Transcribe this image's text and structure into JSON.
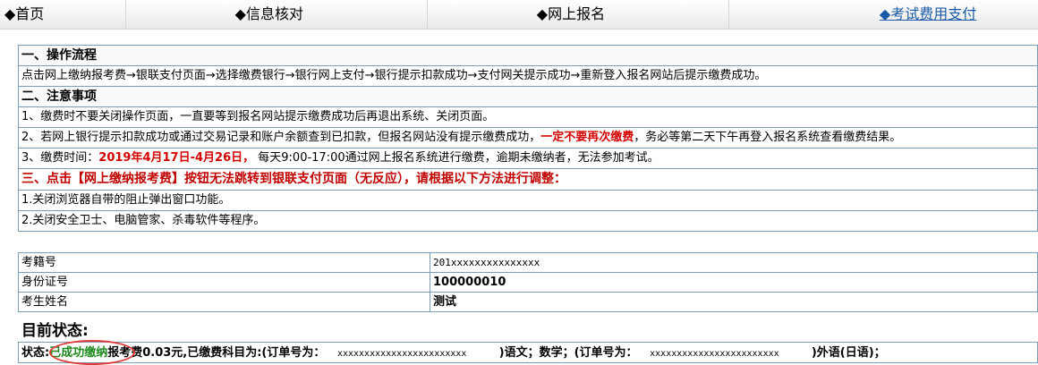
{
  "nav": [
    {
      "label": "◆首页"
    },
    {
      "label": "◆信息核对"
    },
    {
      "label": "◆网上报名"
    },
    {
      "label": "◆考试费用支付"
    }
  ],
  "panel": {
    "sec1_title": "一、操作流程",
    "sec1_text": "点击网上缴纳报考费→银联支付页面→选择缴费银行→银行网上支付→银行提示扣款成功→支付网关提示成功→重新登入报名网站后提示缴费成功。",
    "sec2_title": "二、注意事项",
    "note1": "1、缴费时不要关闭操作页面，一直要等到报名网站提示缴费成功后再退出系统、关闭页面。",
    "note2_a": "2、若网上银行提示扣款成功或通过交易记录和账户余额查到已扣款，但报名网站没有提示缴费成功，",
    "note2_red": "一定不要再次缴费",
    "note2_b": "，务必等第二天下午再登入报名系统查看缴费结果。",
    "note3_a": "3、缴费时间：",
    "note3_red": "2019年4月17日-4月26日，",
    "note3_b": " 每天9:00-17:00通过网上报名系统进行缴费，逾期未缴纳者，无法参加考试。",
    "sec3_title": "三、点击【网上缴纳报考费】按钮无法跳转到银联支付页面（无反应），请根据以下方法进行调整：",
    "fix1": "1.关闭浏览器自带的阻止弹出窗口功能。",
    "fix2": "2.关闭安全卫士、电脑管家、杀毒软件等程序。"
  },
  "info": {
    "rows": [
      {
        "label": "考籍号",
        "value": "201xxxxxxxxxxxxxxx"
      },
      {
        "label": "身份证号",
        "value": "100000010"
      },
      {
        "label": "考生姓名",
        "value": "测试"
      }
    ]
  },
  "status": {
    "title": "目前状态:",
    "prefix": "状态:",
    "state": "已成功缴纳",
    "text1": "报考费0.03元,已缴费科目为:(订单号为：",
    "order1": "xxxxxxxxxxxxxxxxxxxxxxxx",
    "text2": ")语文；数学；(订单号为：",
    "order2": "xxxxxxxxxxxxxxxxxxxxxxxx",
    "text3": ")外语(日语)；"
  }
}
